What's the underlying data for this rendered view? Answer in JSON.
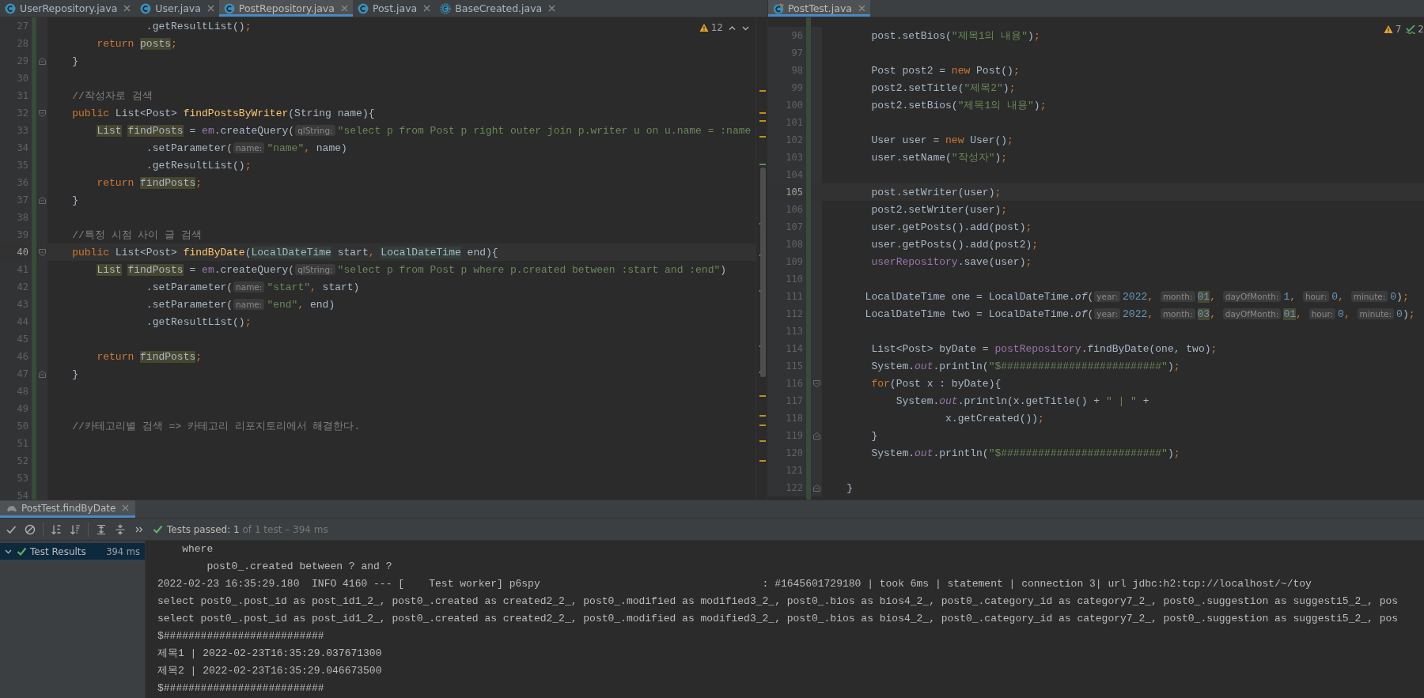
{
  "editors": [
    {
      "tabs": [
        {
          "label": "UserRepository.java",
          "kind": "class",
          "selected": false
        },
        {
          "label": "User.java",
          "kind": "class",
          "selected": false
        },
        {
          "label": "PostRepository.java",
          "kind": "class",
          "selected": true
        },
        {
          "label": "Post.java",
          "kind": "class",
          "selected": false
        },
        {
          "label": "BaseCreated.java",
          "kind": "abstract_class",
          "selected": false
        }
      ],
      "inspections": [
        {
          "kind": "warning",
          "count": "12"
        }
      ],
      "nav_arrows": true,
      "lines": [
        {
          "number": "27",
          "current": false,
          "segments": [
            {
              "kind": "plain",
              "text": "                .getResultList()"
            },
            {
              "kind": "keyword",
              "text": ";"
            }
          ]
        },
        {
          "number": "28",
          "current": false,
          "segments": [
            {
              "kind": "keyword",
              "text": "        return "
            },
            {
              "kind": "usage",
              "text": "posts"
            },
            {
              "kind": "keyword",
              "text": ";"
            }
          ]
        },
        {
          "number": "29",
          "current": false,
          "fold": {
            "kind": "end"
          },
          "segments": [
            {
              "kind": "plain",
              "text": "    }"
            }
          ]
        },
        {
          "number": "30",
          "current": false
        },
        {
          "number": "31",
          "current": false,
          "segments": [
            {
              "kind": "comment",
              "text": "    //작성자로 검색"
            }
          ]
        },
        {
          "number": "32",
          "current": false,
          "fold": {
            "kind": "start"
          },
          "segments": [
            {
              "kind": "keyword",
              "text": "    public "
            },
            {
              "kind": "plain",
              "text": "List<Post> "
            },
            {
              "kind": "method",
              "text": "findPostsByWriter"
            },
            {
              "kind": "plain",
              "text": "(String name){"
            }
          ]
        },
        {
          "number": "33",
          "current": false,
          "segments": [
            {
              "kind": "usage",
              "text": "        List"
            },
            {
              "kind": "usage",
              "text": " findPosts"
            },
            {
              "kind": "plain",
              "text": " = "
            },
            {
              "kind": "field",
              "text": "em"
            },
            {
              "kind": "plain",
              "text": ".createQuery("
            },
            {
              "kind": "hint",
              "text": "qlString:"
            },
            {
              "kind": "string",
              "text": "\"select p from Post p right outer join p.writer u on u.name = :name"
            }
          ]
        },
        {
          "number": "34",
          "current": false,
          "segments": [
            {
              "kind": "plain",
              "text": "                .setParameter("
            },
            {
              "kind": "hint",
              "text": "name:"
            },
            {
              "kind": "string",
              "text": "\"name\""
            },
            {
              "kind": "keyword",
              "text": ", "
            },
            {
              "kind": "plain",
              "text": "name)"
            }
          ]
        },
        {
          "number": "35",
          "current": false,
          "segments": [
            {
              "kind": "plain",
              "text": "                .getResultList()"
            },
            {
              "kind": "keyword",
              "text": ";"
            }
          ]
        },
        {
          "number": "36",
          "current": false,
          "segments": [
            {
              "kind": "keyword",
              "text": "        return "
            },
            {
              "kind": "usage",
              "text": "findPosts"
            },
            {
              "kind": "keyword",
              "text": ";"
            }
          ]
        },
        {
          "number": "37",
          "current": false,
          "fold": {
            "kind": "end"
          },
          "segments": [
            {
              "kind": "plain",
              "text": "    }"
            }
          ]
        },
        {
          "number": "38",
          "current": false
        },
        {
          "number": "39",
          "current": false,
          "segments": [
            {
              "kind": "comment",
              "text": "    //특정 시점 사이 글 검색"
            }
          ]
        },
        {
          "number": "40",
          "current": true,
          "fold": {
            "kind": "start"
          },
          "segments": [
            {
              "kind": "keyword",
              "text": "    public "
            },
            {
              "kind": "plain",
              "text": "List<Post> "
            },
            {
              "kind": "method",
              "text": "findByDate"
            },
            {
              "kind": "plain",
              "text": "("
            },
            {
              "kind": "type_usage",
              "text": "LocalDateTime"
            },
            {
              "kind": "plain",
              "text": " start"
            },
            {
              "kind": "keyword",
              "text": ", "
            },
            {
              "kind": "type_usage",
              "text": "LocalDateTime"
            },
            {
              "kind": "plain",
              "text": " end){"
            }
          ]
        },
        {
          "number": "41",
          "current": false,
          "segments": [
            {
              "kind": "usage",
              "text": "        List"
            },
            {
              "kind": "usage",
              "text": " findPosts"
            },
            {
              "kind": "plain",
              "text": " = "
            },
            {
              "kind": "field",
              "text": "em"
            },
            {
              "kind": "plain",
              "text": ".createQuery("
            },
            {
              "kind": "hint",
              "text": "qlString:"
            },
            {
              "kind": "string",
              "text": "\"select p from Post p where p.created between :start and :end\""
            },
            {
              "kind": "plain",
              "text": ")"
            }
          ]
        },
        {
          "number": "42",
          "current": false,
          "segments": [
            {
              "kind": "plain",
              "text": "                .setParameter("
            },
            {
              "kind": "hint",
              "text": "name:"
            },
            {
              "kind": "string",
              "text": "\"start\""
            },
            {
              "kind": "keyword",
              "text": ", "
            },
            {
              "kind": "plain",
              "text": "start)"
            }
          ]
        },
        {
          "number": "43",
          "current": false,
          "segments": [
            {
              "kind": "plain",
              "text": "                .setParameter("
            },
            {
              "kind": "hint",
              "text": "name:"
            },
            {
              "kind": "string",
              "text": "\"end\""
            },
            {
              "kind": "keyword",
              "text": ", "
            },
            {
              "kind": "plain",
              "text": "end)"
            }
          ]
        },
        {
          "number": "44",
          "current": false,
          "segments": [
            {
              "kind": "plain",
              "text": "                .getResultList()"
            },
            {
              "kind": "keyword",
              "text": ";"
            }
          ]
        },
        {
          "number": "45",
          "current": false
        },
        {
          "number": "46",
          "current": false,
          "segments": [
            {
              "kind": "keyword",
              "text": "        return "
            },
            {
              "kind": "usage",
              "text": "findPosts"
            },
            {
              "kind": "keyword",
              "text": ";"
            }
          ]
        },
        {
          "number": "47",
          "current": false,
          "fold": {
            "kind": "end"
          },
          "segments": [
            {
              "kind": "plain",
              "text": "    }"
            }
          ]
        },
        {
          "number": "48",
          "current": false
        },
        {
          "number": "49",
          "current": false
        },
        {
          "number": "50",
          "current": false,
          "segments": [
            {
              "kind": "comment",
              "text": "    //카테고리별 검색 => 카테고리 리포지토리에서 해결한다."
            }
          ]
        },
        {
          "number": "51",
          "current": false
        },
        {
          "number": "52",
          "current": false
        },
        {
          "number": "53",
          "current": false
        },
        {
          "number": "54",
          "current": false
        }
      ]
    },
    {
      "tabs": [
        {
          "label": "PostTest.java",
          "kind": "test_class",
          "selected": true
        }
      ],
      "inspections": [
        {
          "kind": "warning",
          "count": "7"
        },
        {
          "kind": "typo",
          "count": "2"
        }
      ],
      "nav_arrows": false,
      "lines": [
        {
          "number": "96",
          "current": false,
          "segments": [
            {
              "kind": "plain",
              "text": "        post.setBios("
            },
            {
              "kind": "string",
              "text": "\"제목1의 내용\""
            },
            {
              "kind": "plain",
              "text": ")"
            },
            {
              "kind": "keyword",
              "text": ";"
            }
          ]
        },
        {
          "number": "97",
          "current": false
        },
        {
          "number": "98",
          "current": false,
          "segments": [
            {
              "kind": "plain",
              "text": "        Post post2 = "
            },
            {
              "kind": "keyword",
              "text": "new"
            },
            {
              "kind": "plain",
              "text": " Post()"
            },
            {
              "kind": "keyword",
              "text": ";"
            }
          ]
        },
        {
          "number": "99",
          "current": false,
          "segments": [
            {
              "kind": "plain",
              "text": "        post2.setTitle("
            },
            {
              "kind": "string",
              "text": "\"제목2\""
            },
            {
              "kind": "plain",
              "text": ")"
            },
            {
              "kind": "keyword",
              "text": ";"
            }
          ]
        },
        {
          "number": "100",
          "current": false,
          "segments": [
            {
              "kind": "plain",
              "text": "        post2.setBios("
            },
            {
              "kind": "string",
              "text": "\"제목1의 내용\""
            },
            {
              "kind": "plain",
              "text": ")"
            },
            {
              "kind": "keyword",
              "text": ";"
            }
          ]
        },
        {
          "number": "101",
          "current": false
        },
        {
          "number": "102",
          "current": false,
          "segments": [
            {
              "kind": "plain",
              "text": "        User user = "
            },
            {
              "kind": "keyword",
              "text": "new"
            },
            {
              "kind": "plain",
              "text": " User()"
            },
            {
              "kind": "keyword",
              "text": ";"
            }
          ]
        },
        {
          "number": "103",
          "current": false,
          "segments": [
            {
              "kind": "plain",
              "text": "        user.setName("
            },
            {
              "kind": "string",
              "text": "\"작성자\""
            },
            {
              "kind": "plain",
              "text": ")"
            },
            {
              "kind": "keyword",
              "text": ";"
            }
          ]
        },
        {
          "number": "104",
          "current": false
        },
        {
          "number": "105",
          "current": true,
          "segments": [
            {
              "kind": "plain",
              "text": "        post.setWriter(user)"
            },
            {
              "kind": "keyword",
              "text": ";"
            }
          ]
        },
        {
          "number": "106",
          "current": false,
          "segments": [
            {
              "kind": "plain",
              "text": "        post2.setWriter(user)"
            },
            {
              "kind": "keyword",
              "text": ";"
            }
          ]
        },
        {
          "number": "107",
          "current": false,
          "segments": [
            {
              "kind": "plain",
              "text": "        user.getPosts().add(post)"
            },
            {
              "kind": "keyword",
              "text": ";"
            }
          ]
        },
        {
          "number": "108",
          "current": false,
          "segments": [
            {
              "kind": "plain",
              "text": "        user.getPosts().add(post2)"
            },
            {
              "kind": "keyword",
              "text": ";"
            }
          ]
        },
        {
          "number": "109",
          "current": false,
          "segments": [
            {
              "kind": "field",
              "text": "        userRepository"
            },
            {
              "kind": "plain",
              "text": ".save(user)"
            },
            {
              "kind": "keyword",
              "text": ";"
            }
          ]
        },
        {
          "number": "110",
          "current": false
        },
        {
          "number": "111",
          "current": false,
          "segments": [
            {
              "kind": "plain",
              "text": "       LocalDateTime one = LocalDateTime."
            },
            {
              "kind": "italic",
              "text": "of"
            },
            {
              "kind": "plain",
              "text": "("
            },
            {
              "kind": "hint",
              "text": "year:"
            },
            {
              "kind": "number",
              "text": "2022"
            },
            {
              "kind": "keyword",
              "text": ", "
            },
            {
              "kind": "hint",
              "text": "month:"
            },
            {
              "kind": "number_usage",
              "text": "01"
            },
            {
              "kind": "keyword",
              "text": ", "
            },
            {
              "kind": "hint",
              "text": "dayOfMonth:"
            },
            {
              "kind": "number",
              "text": "1"
            },
            {
              "kind": "keyword",
              "text": ", "
            },
            {
              "kind": "hint",
              "text": "hour:"
            },
            {
              "kind": "number",
              "text": "0"
            },
            {
              "kind": "keyword",
              "text": ", "
            },
            {
              "kind": "hint",
              "text": "minute:"
            },
            {
              "kind": "number",
              "text": "0"
            },
            {
              "kind": "plain",
              "text": ")"
            },
            {
              "kind": "keyword",
              "text": ";"
            }
          ]
        },
        {
          "number": "112",
          "current": false,
          "segments": [
            {
              "kind": "plain",
              "text": "       LocalDateTime two = LocalDateTime."
            },
            {
              "kind": "italic",
              "text": "of"
            },
            {
              "kind": "plain",
              "text": "("
            },
            {
              "kind": "hint",
              "text": "year:"
            },
            {
              "kind": "number",
              "text": "2022"
            },
            {
              "kind": "keyword",
              "text": ", "
            },
            {
              "kind": "hint",
              "text": "month:"
            },
            {
              "kind": "number_usage",
              "text": "03"
            },
            {
              "kind": "keyword",
              "text": ", "
            },
            {
              "kind": "hint",
              "text": "dayOfMonth:"
            },
            {
              "kind": "number_usage",
              "text": "01"
            },
            {
              "kind": "keyword",
              "text": ", "
            },
            {
              "kind": "hint",
              "text": "hour:"
            },
            {
              "kind": "number",
              "text": "0"
            },
            {
              "kind": "keyword",
              "text": ", "
            },
            {
              "kind": "hint",
              "text": "minute:"
            },
            {
              "kind": "number",
              "text": "0"
            },
            {
              "kind": "plain",
              "text": ")"
            },
            {
              "kind": "keyword",
              "text": ";"
            }
          ]
        },
        {
          "number": "113",
          "current": false
        },
        {
          "number": "114",
          "current": false,
          "segments": [
            {
              "kind": "plain",
              "text": "        List<Post> byDate = "
            },
            {
              "kind": "field",
              "text": "postRepository"
            },
            {
              "kind": "plain",
              "text": ".findByDate(one, two)"
            },
            {
              "kind": "keyword",
              "text": ";"
            }
          ]
        },
        {
          "number": "115",
          "current": false,
          "segments": [
            {
              "kind": "plain",
              "text": "        System."
            },
            {
              "kind": "static_field",
              "text": "out"
            },
            {
              "kind": "plain",
              "text": ".println("
            },
            {
              "kind": "string",
              "text": "\"$##########################\""
            },
            {
              "kind": "plain",
              "text": ")"
            },
            {
              "kind": "keyword",
              "text": ";"
            }
          ]
        },
        {
          "number": "116",
          "current": false,
          "fold": {
            "kind": "start"
          },
          "segments": [
            {
              "kind": "keyword",
              "text": "        for"
            },
            {
              "kind": "plain",
              "text": "(Post x : byDate){"
            }
          ]
        },
        {
          "number": "117",
          "current": false,
          "segments": [
            {
              "kind": "plain",
              "text": "            System."
            },
            {
              "kind": "static_field",
              "text": "out"
            },
            {
              "kind": "plain",
              "text": ".println(x.getTitle() + "
            },
            {
              "kind": "string",
              "text": "\" | \""
            },
            {
              "kind": "plain",
              "text": " +"
            }
          ]
        },
        {
          "number": "118",
          "current": false,
          "segments": [
            {
              "kind": "plain",
              "text": "                    x.getCreated())"
            },
            {
              "kind": "keyword",
              "text": ";"
            }
          ]
        },
        {
          "number": "119",
          "current": false,
          "fold": {
            "kind": "end"
          },
          "segments": [
            {
              "kind": "plain",
              "text": "        }"
            }
          ]
        },
        {
          "number": "120",
          "current": false,
          "segments": [
            {
              "kind": "plain",
              "text": "        System."
            },
            {
              "kind": "static_field",
              "text": "out"
            },
            {
              "kind": "plain",
              "text": ".println("
            },
            {
              "kind": "string",
              "text": "\"$##########################\""
            },
            {
              "kind": "plain",
              "text": ")"
            },
            {
              "kind": "keyword",
              "text": ";"
            }
          ]
        },
        {
          "number": "121",
          "current": false
        },
        {
          "number": "122",
          "current": false,
          "fold": {
            "kind": "end"
          },
          "segments": [
            {
              "kind": "plain",
              "text": "    }"
            }
          ]
        }
      ]
    }
  ],
  "run_panel": {
    "tab": {
      "label": "PostTest.findByDate"
    },
    "toolbar": [
      {
        "kind": "check"
      },
      {
        "kind": "cancel"
      },
      {
        "kind": "sort_alpha"
      },
      {
        "kind": "sort_duration"
      },
      {
        "kind": "expand"
      },
      {
        "kind": "collapse"
      },
      {
        "kind": "more"
      }
    ],
    "status": {
      "main": "Tests passed: 1",
      "detail": "of 1 test – 394 ms"
    },
    "tree": [
      {
        "label": "Test Results",
        "time": "394 ms",
        "selected": true,
        "expanded": true
      }
    ],
    "console": [
      "    where",
      "        post0_.created between ? and ?",
      "2022-02-23 16:35:29.180  INFO 4160 --- [    Test worker] p6spy                                    : #1645601729180 | took 6ms | statement | connection 3| url jdbc:h2:tcp://localhost/~/toy",
      "select post0_.post_id as post_id1_2_, post0_.created as created2_2_, post0_.modified as modified3_2_, post0_.bios as bios4_2_, post0_.category_id as category7_2_, post0_.suggestion as suggesti5_2_, pos",
      "select post0_.post_id as post_id1_2_, post0_.created as created2_2_, post0_.modified as modified3_2_, post0_.bios as bios4_2_, post0_.category_id as category7_2_, post0_.suggestion as suggesti5_2_, pos",
      "$##########################",
      "제목1 | 2022-02-23T16:35:29.037671300",
      "제목2 | 2022-02-23T16:35:29.046673500",
      "$##########################"
    ]
  }
}
